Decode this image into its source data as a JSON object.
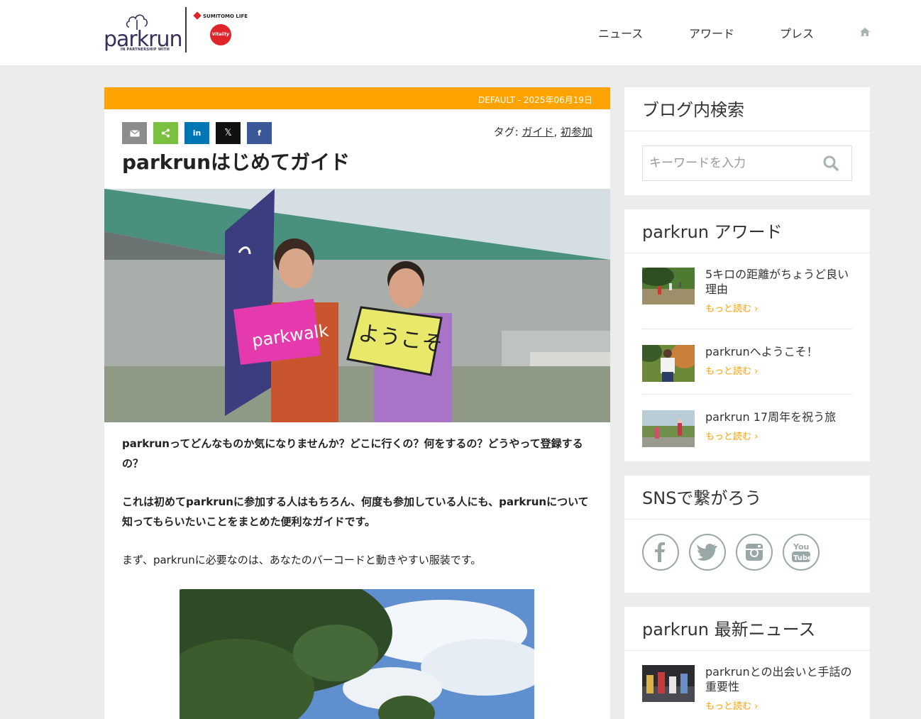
{
  "header": {
    "logo_text": "parkrun",
    "logo_tagline": "IN PARTNERSHIP WITH",
    "sponsor_name": "SUMITOMO LIFE",
    "sponsor_badge": "Vitality",
    "nav": [
      {
        "label": "ニュース"
      },
      {
        "label": "アワード"
      },
      {
        "label": "プレス"
      }
    ],
    "home_icon": "home-icon"
  },
  "article": {
    "meta": "DEFAULT - 2025年06月19日",
    "share_buttons": [
      "email-icon",
      "share-icon",
      "linkedin-icon",
      "x-icon",
      "facebook-icon"
    ],
    "share_colors": [
      "#8c8c8c",
      "#7ac142",
      "#0077b5",
      "#111111",
      "#3b5998"
    ],
    "tags_label": "タグ: ",
    "tags": [
      "ガイド",
      "初参加"
    ],
    "tag_separator": ", ",
    "title": "parkrunはじめてガイド",
    "hero_sign_left": "parkwalk",
    "hero_sign_right": "ようこそ",
    "paragraphs": [
      "parkrunってどんなものか気になりませんか？どこに行くの？何をするの？どうやって登録するの？",
      "これは初めてparkrunに参加する人はもちろん、何度も参加している人にも、parkrunについて知ってもらいたいことをまとめた便利なガイドです。",
      "まず、parkrunに必要なのは、あなたのバーコードと動きやすい服装です。"
    ]
  },
  "sidebar": {
    "search": {
      "title": "ブログ内検索",
      "placeholder": "キーワードを入力"
    },
    "awards": {
      "title": "parkrun アワード",
      "posts": [
        {
          "title": "5キロの距離がちょうど良い理由",
          "more": "もっと読む ›"
        },
        {
          "title": "parkrunへようこそ！",
          "more": "もっと読む ›"
        },
        {
          "title": "parkrun 17周年を祝う旅",
          "more": "もっと読む ›"
        }
      ]
    },
    "social": {
      "title": "SNSで繋がろう",
      "icons": [
        "facebook-icon",
        "twitter-icon",
        "instagram-icon",
        "youtube-icon"
      ],
      "icon_color": "#9aa7a7"
    },
    "news": {
      "title": "parkrun 最新ニュース",
      "posts": [
        {
          "title": "parkrunとの出会いと手話の重要性",
          "more": "もっと読む ›"
        }
      ]
    }
  },
  "colors": {
    "accent": "#ffa300",
    "background": "#ececec"
  }
}
